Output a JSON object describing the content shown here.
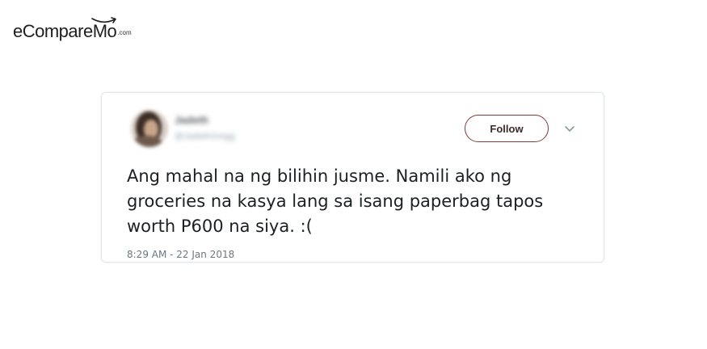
{
  "logo": {
    "main": "eCompareMo",
    "suffix": ".com"
  },
  "tweet": {
    "author": {
      "display_name": "Jadeth",
      "handle": "@JadethGregg"
    },
    "follow_label": "Follow",
    "text": "Ang mahal na ng bilihin jusme. Namili ako ng groceries na kasya lang sa isang paperbag tapos worth P600 na siya. :(",
    "timestamp": "8:29 AM - 22 Jan 2018"
  },
  "colors": {
    "follow_border": "#7f3a3a",
    "card_border": "#e1e8ed",
    "text": "#1c2022",
    "meta": "#697882"
  },
  "icons": {
    "menu": "chevron-down-icon",
    "logo_accent": "smile-arrow-icon"
  }
}
